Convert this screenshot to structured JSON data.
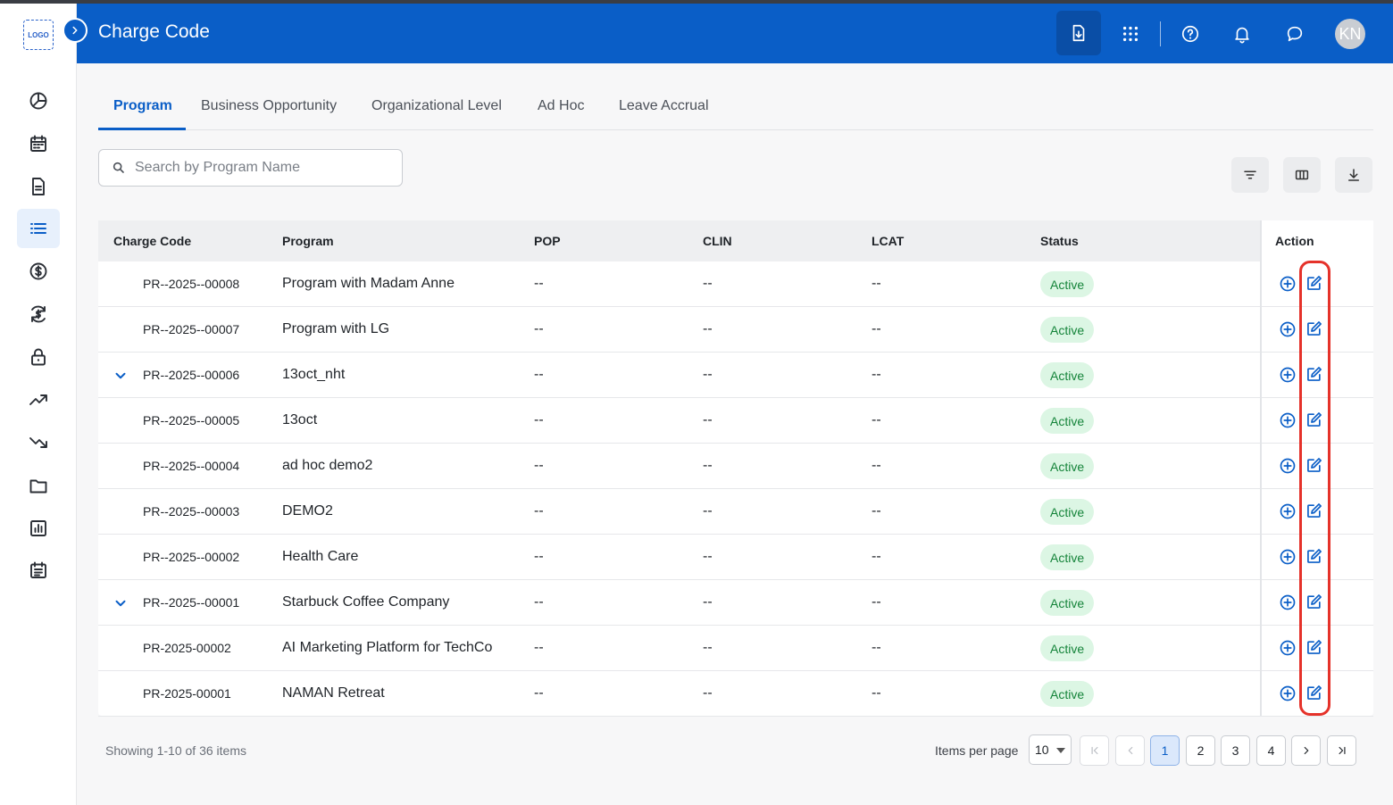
{
  "app": {
    "logo_text": "LOGO",
    "title": "Charge Code",
    "user_initials": "KN"
  },
  "sidebar": {
    "icons": [
      "dashboard-pie-icon",
      "calendar-icon",
      "document-icon",
      "list-icon",
      "dollar-icon",
      "currency-exchange-icon",
      "lock-icon",
      "trending-up-icon",
      "trending-down-icon",
      "folder-icon",
      "report-chart-icon",
      "schedule-icon"
    ],
    "active_index": 3
  },
  "header": {
    "icons": [
      "document-download-icon",
      "apps-grid-icon",
      "help-icon",
      "bell-icon",
      "chat-icon"
    ]
  },
  "tabs": [
    {
      "label": "Program",
      "active": true
    },
    {
      "label": "Business Opportunity",
      "active": false
    },
    {
      "label": "Organizational Level",
      "active": false
    },
    {
      "label": "Ad Hoc",
      "active": false
    },
    {
      "label": "Leave Accrual",
      "active": false
    }
  ],
  "search": {
    "placeholder": "Search by Program Name",
    "value": ""
  },
  "table": {
    "columns": [
      "Charge Code",
      "Program",
      "POP",
      "CLIN",
      "LCAT",
      "Status",
      "Action"
    ],
    "rows": [
      {
        "code": "PR--2025--00008",
        "program": "Program with Madam Anne",
        "pop": "--",
        "clin": "--",
        "lcat": "--",
        "status": "Active",
        "expandable": false
      },
      {
        "code": "PR--2025--00007",
        "program": "Program with LG",
        "pop": "--",
        "clin": "--",
        "lcat": "--",
        "status": "Active",
        "expandable": false
      },
      {
        "code": "PR--2025--00006",
        "program": "13oct_nht",
        "pop": "--",
        "clin": "--",
        "lcat": "--",
        "status": "Active",
        "expandable": true
      },
      {
        "code": "PR--2025--00005",
        "program": "13oct",
        "pop": "--",
        "clin": "--",
        "lcat": "--",
        "status": "Active",
        "expandable": false
      },
      {
        "code": "PR--2025--00004",
        "program": "ad hoc demo2",
        "pop": "--",
        "clin": "--",
        "lcat": "--",
        "status": "Active",
        "expandable": false
      },
      {
        "code": "PR--2025--00003",
        "program": "DEMO2",
        "pop": "--",
        "clin": "--",
        "lcat": "--",
        "status": "Active",
        "expandable": false
      },
      {
        "code": "PR--2025--00002",
        "program": "Health Care",
        "pop": "--",
        "clin": "--",
        "lcat": "--",
        "status": "Active",
        "expandable": false
      },
      {
        "code": "PR--2025--00001",
        "program": "Starbuck Coffee Company",
        "pop": "--",
        "clin": "--",
        "lcat": "--",
        "status": "Active",
        "expandable": true
      },
      {
        "code": "PR-2025-00002",
        "program": "AI Marketing Platform for TechCo",
        "pop": "--",
        "clin": "--",
        "lcat": "--",
        "status": "Active",
        "expandable": false
      },
      {
        "code": "PR-2025-00001",
        "program": "NAMAN Retreat",
        "pop": "--",
        "clin": "--",
        "lcat": "--",
        "status": "Active",
        "expandable": false
      }
    ]
  },
  "pagination": {
    "showing_text": "Showing 1-10 of 36 items",
    "items_per_page_label": "Items per page",
    "items_per_page": "10",
    "pages": [
      "1",
      "2",
      "3",
      "4"
    ],
    "current_page": "1"
  },
  "colors": {
    "brand": "#0a5ec7",
    "status_active_bg": "#dcf6e4",
    "status_active_text": "#15843a",
    "highlight": "#e5322a"
  }
}
